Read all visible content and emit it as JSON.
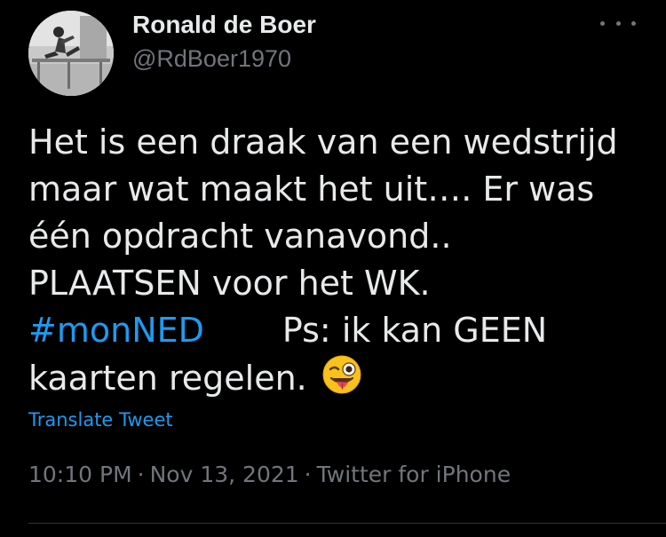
{
  "author": {
    "name": "Ronald de Boer",
    "handle": "@RdBoer1970"
  },
  "tweet": {
    "lines": [
      "Het is een draak van een wedstrijd",
      "maar wat maakt het uit…. Er was",
      "één opdracht vanavond..",
      "PLAATSEN voor het WK."
    ],
    "hashtag": "#monNED",
    "after_hashtag": "Ps: ik kan GEEN",
    "last_line": "kaarten regelen.",
    "emoji": "winking-face-with-tongue"
  },
  "translate_label": "Translate Tweet",
  "meta": {
    "time": "10:10 PM",
    "date": "Nov 13, 2021",
    "source": "Twitter for iPhone",
    "separator": "·"
  },
  "colors": {
    "background": "#000000",
    "text": "#e7e9ea",
    "secondary": "#71767b",
    "link": "#1d9bf0",
    "divider": "#2f3336"
  },
  "icons": {
    "more": "more-horizontal-icon"
  }
}
